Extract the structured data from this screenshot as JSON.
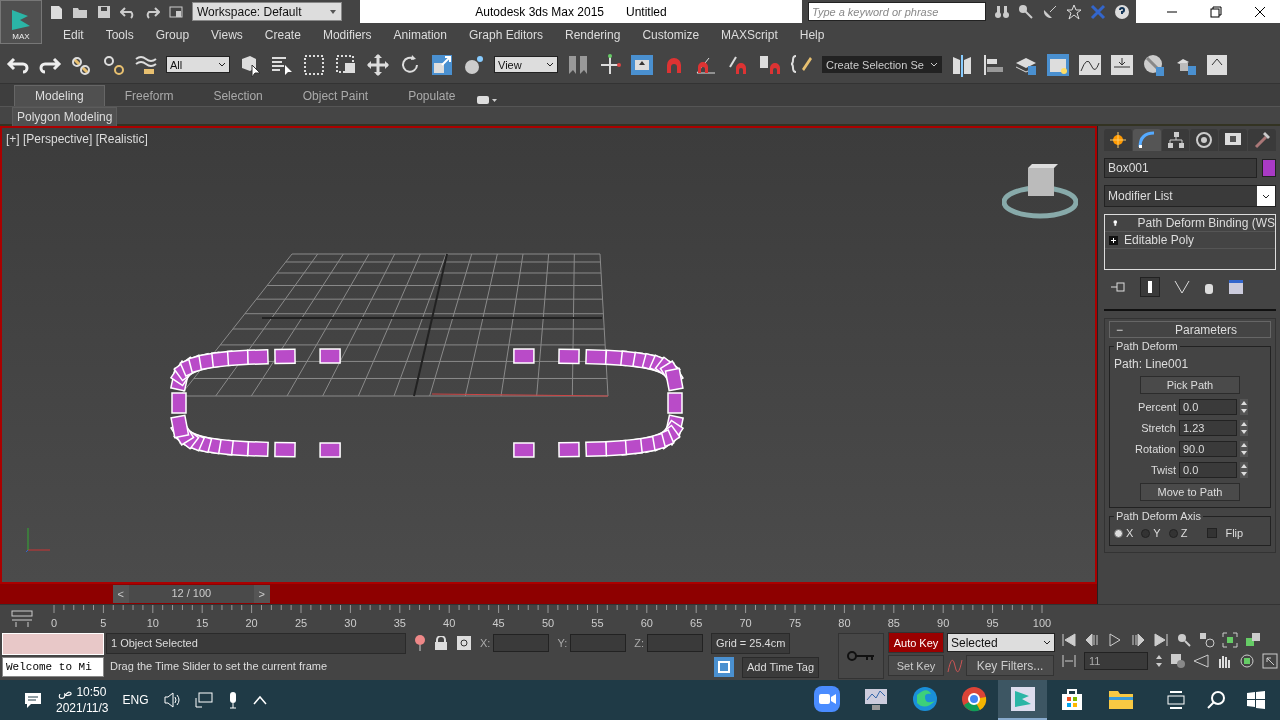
{
  "app": {
    "logo": "MAX"
  },
  "workspace": {
    "label": "Workspace: Default"
  },
  "window": {
    "title": "Autodesk 3ds Max  2015",
    "document": "Untitled"
  },
  "search": {
    "placeholder": "Type a keyword or phrase"
  },
  "menu": [
    "Edit",
    "Tools",
    "Group",
    "Views",
    "Create",
    "Modifiers",
    "Animation",
    "Graph Editors",
    "Rendering",
    "Customize",
    "MAXScript",
    "Help"
  ],
  "toolbar": {
    "selection_filter": "All",
    "reference_coord": "View",
    "named_selection": "Create Selection Se"
  },
  "ribbon": {
    "tabs": [
      {
        "label": "Modeling",
        "selected": true
      },
      {
        "label": "Freeform",
        "selected": false
      },
      {
        "label": "Selection",
        "selected": false
      },
      {
        "label": "Object Paint",
        "selected": false
      },
      {
        "label": "Populate",
        "selected": false
      }
    ],
    "panel": "Polygon Modeling"
  },
  "viewport": {
    "label": "[+] [Perspective] [Realistic]"
  },
  "command_panel": {
    "tabs": [
      {
        "kind": "create",
        "selected": false
      },
      {
        "kind": "modify",
        "selected": true
      },
      {
        "kind": "hierarchy",
        "selected": false
      },
      {
        "kind": "motion",
        "selected": false
      },
      {
        "kind": "display",
        "selected": false
      },
      {
        "kind": "utilities",
        "selected": false
      }
    ],
    "object_name": "Box001",
    "modifier_list": "Modifier List",
    "stack": [
      {
        "label": "Path Deform Binding (WS",
        "kind": "modifier"
      },
      {
        "label": "Editable Poly",
        "kind": "base"
      }
    ],
    "rollout": {
      "symbol": "−",
      "title": "Parameters",
      "group": "Path Deform",
      "path": "Path: Line001",
      "pick": "Pick Path",
      "spinners": [
        {
          "label": "Percent",
          "value": "0.0"
        },
        {
          "label": "Stretch",
          "value": "1.23"
        },
        {
          "label": "Rotation",
          "value": "90.0"
        },
        {
          "label": "Twist",
          "value": "0.0"
        }
      ],
      "move": "Move to Path",
      "axis_group": "Path Deform Axis",
      "axes": [
        {
          "label": "X",
          "selected": true
        },
        {
          "label": "Y",
          "selected": false
        },
        {
          "label": "Z",
          "selected": false
        }
      ],
      "flip": {
        "label": "Flip",
        "checked": false
      }
    }
  },
  "time_slider": {
    "prev": "<",
    "label": "12 / 100",
    "next": ">",
    "level": 0.12
  },
  "track_bar": {
    "ticks": [
      "0",
      "5",
      "10",
      "15",
      "20",
      "25",
      "30",
      "35",
      "40",
      "45",
      "50",
      "55",
      "60",
      "65",
      "70",
      "75",
      "80",
      "85",
      "90",
      "95",
      "100"
    ]
  },
  "status": {
    "listener": "Welcome to Mi",
    "selection": "1 Object Selected",
    "prompt": "Drag the Time Slider to set the current frame",
    "coords": [
      "X:",
      "Y:",
      "Z:"
    ],
    "grid": "Grid = 25.4cm",
    "time_tag": "Add Time Tag"
  },
  "animation": {
    "auto_key": {
      "label": "Auto Key",
      "on": true
    },
    "set_key": "Set Key",
    "key_mode": "Selected",
    "key_filters": "Key Filters...",
    "frame": "11"
  },
  "taskbar": {
    "time": "10:50 ص",
    "date": "2021/11/3",
    "language": "ENG",
    "apps": [
      {
        "kind": "video",
        "selected": false
      },
      {
        "kind": "monitor",
        "selected": false
      },
      {
        "kind": "browser-wave",
        "selected": false
      },
      {
        "kind": "browser-ring",
        "selected": false
      },
      {
        "kind": "max",
        "selected": true
      },
      {
        "kind": "store",
        "selected": false
      },
      {
        "kind": "folder",
        "selected": false
      }
    ]
  }
}
